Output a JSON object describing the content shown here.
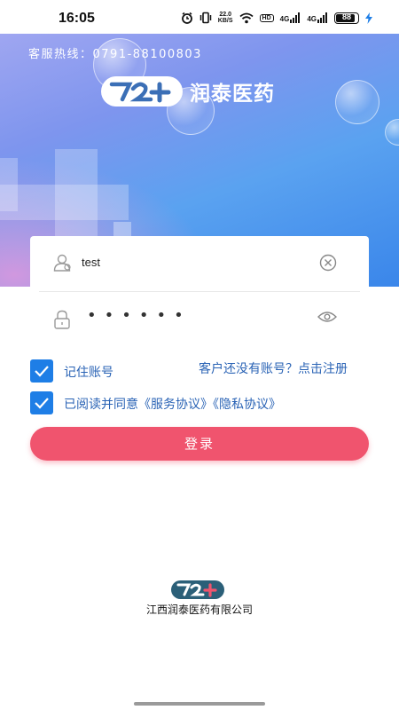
{
  "status_bar": {
    "time": "16:05",
    "net_speed_value": "22.0",
    "net_speed_unit": "KB/S",
    "hd_label": "HD",
    "signal1_label": "4G",
    "signal2_label": "4G",
    "battery_level": "88",
    "icons": [
      "alarm-icon",
      "vibrate-icon",
      "wifi-icon",
      "charging-icon"
    ]
  },
  "header": {
    "hotline": "客服热线：0791-88100803",
    "brand_name": "润泰医药"
  },
  "login_form": {
    "username_value": "test",
    "password_mask": "••••••",
    "username_icon": "user-icon",
    "password_icon": "lock-icon",
    "clear_icon": "clear-icon",
    "eye_icon": "eye-icon"
  },
  "options": {
    "remember_label": "记住账号",
    "remember_checked": true,
    "register_link": "客户还没有账号？点击注册",
    "agree_label": "已阅读并同意《服务协议》《隐私协议》",
    "agree_checked": true
  },
  "login_button": "登录",
  "footer": {
    "company": "江西润泰医药有限公司"
  },
  "colors": {
    "primary_blue": "#1e7ee6",
    "link_blue": "#2a63b5",
    "button_red": "#f0546e",
    "logo_dark": "#2b5f78"
  }
}
